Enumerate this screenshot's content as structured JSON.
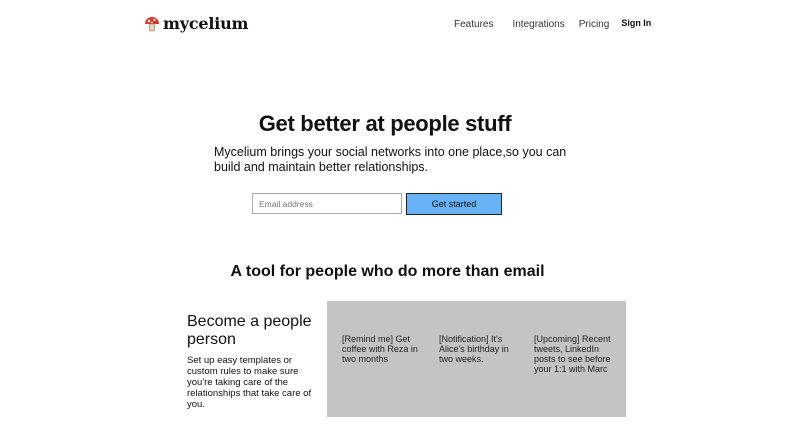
{
  "nav": {
    "brand": "mycelium",
    "brand_icon": "mushroom-icon",
    "links": {
      "features": "Features",
      "integrations": "Integrations",
      "pricing": "Pricing",
      "signin": "Sign In"
    }
  },
  "hero": {
    "title": "Get better at people stuff",
    "subtitle": "Mycelium brings your social networks into one place,so you can build and maintain better relationships.",
    "email_placeholder": "Email address",
    "cta_label": "Get started"
  },
  "section": {
    "title": "A tool for people who do more than email"
  },
  "feature": {
    "heading": "Become a people person",
    "body": "Set up easy templates or custom rules to make sure you're taking care of the relationships that take care of you."
  },
  "panel": {
    "messages": [
      "[Remind me] Get coffee with Reza in two months",
      "[Notification] It's Alice's birthday in two weeks.",
      "[Upcoming] Recent tweets, LinkedIn posts to see before your 1:1 with Marc"
    ]
  },
  "colors": {
    "accent": "#67b2f5",
    "panel_bg": "#c4c4c4",
    "brand_icon": "#d9362b"
  }
}
